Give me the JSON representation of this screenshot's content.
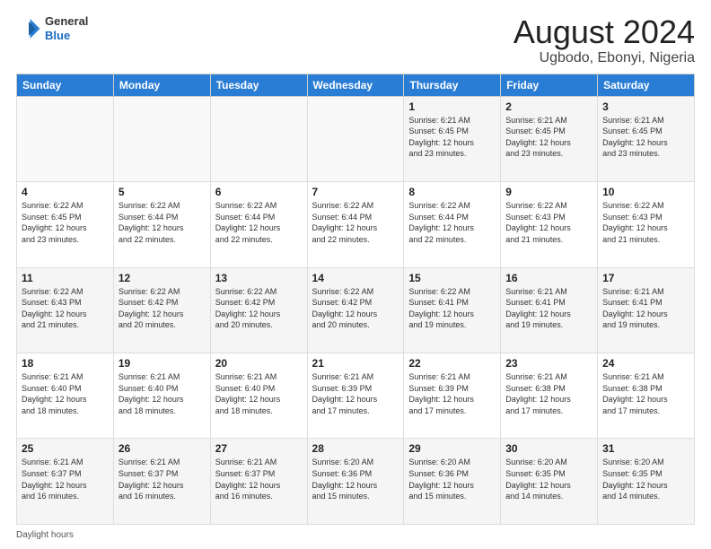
{
  "logo": {
    "general": "General",
    "blue": "Blue"
  },
  "title": "August 2024",
  "subtitle": "Ugbodo, Ebonyi, Nigeria",
  "days_of_week": [
    "Sunday",
    "Monday",
    "Tuesday",
    "Wednesday",
    "Thursday",
    "Friday",
    "Saturday"
  ],
  "footer_label": "Daylight hours",
  "weeks": [
    [
      {
        "day": "",
        "info": ""
      },
      {
        "day": "",
        "info": ""
      },
      {
        "day": "",
        "info": ""
      },
      {
        "day": "",
        "info": ""
      },
      {
        "day": "1",
        "info": "Sunrise: 6:21 AM\nSunset: 6:45 PM\nDaylight: 12 hours\nand 23 minutes."
      },
      {
        "day": "2",
        "info": "Sunrise: 6:21 AM\nSunset: 6:45 PM\nDaylight: 12 hours\nand 23 minutes."
      },
      {
        "day": "3",
        "info": "Sunrise: 6:21 AM\nSunset: 6:45 PM\nDaylight: 12 hours\nand 23 minutes."
      }
    ],
    [
      {
        "day": "4",
        "info": "Sunrise: 6:22 AM\nSunset: 6:45 PM\nDaylight: 12 hours\nand 23 minutes."
      },
      {
        "day": "5",
        "info": "Sunrise: 6:22 AM\nSunset: 6:44 PM\nDaylight: 12 hours\nand 22 minutes."
      },
      {
        "day": "6",
        "info": "Sunrise: 6:22 AM\nSunset: 6:44 PM\nDaylight: 12 hours\nand 22 minutes."
      },
      {
        "day": "7",
        "info": "Sunrise: 6:22 AM\nSunset: 6:44 PM\nDaylight: 12 hours\nand 22 minutes."
      },
      {
        "day": "8",
        "info": "Sunrise: 6:22 AM\nSunset: 6:44 PM\nDaylight: 12 hours\nand 22 minutes."
      },
      {
        "day": "9",
        "info": "Sunrise: 6:22 AM\nSunset: 6:43 PM\nDaylight: 12 hours\nand 21 minutes."
      },
      {
        "day": "10",
        "info": "Sunrise: 6:22 AM\nSunset: 6:43 PM\nDaylight: 12 hours\nand 21 minutes."
      }
    ],
    [
      {
        "day": "11",
        "info": "Sunrise: 6:22 AM\nSunset: 6:43 PM\nDaylight: 12 hours\nand 21 minutes."
      },
      {
        "day": "12",
        "info": "Sunrise: 6:22 AM\nSunset: 6:42 PM\nDaylight: 12 hours\nand 20 minutes."
      },
      {
        "day": "13",
        "info": "Sunrise: 6:22 AM\nSunset: 6:42 PM\nDaylight: 12 hours\nand 20 minutes."
      },
      {
        "day": "14",
        "info": "Sunrise: 6:22 AM\nSunset: 6:42 PM\nDaylight: 12 hours\nand 20 minutes."
      },
      {
        "day": "15",
        "info": "Sunrise: 6:22 AM\nSunset: 6:41 PM\nDaylight: 12 hours\nand 19 minutes."
      },
      {
        "day": "16",
        "info": "Sunrise: 6:21 AM\nSunset: 6:41 PM\nDaylight: 12 hours\nand 19 minutes."
      },
      {
        "day": "17",
        "info": "Sunrise: 6:21 AM\nSunset: 6:41 PM\nDaylight: 12 hours\nand 19 minutes."
      }
    ],
    [
      {
        "day": "18",
        "info": "Sunrise: 6:21 AM\nSunset: 6:40 PM\nDaylight: 12 hours\nand 18 minutes."
      },
      {
        "day": "19",
        "info": "Sunrise: 6:21 AM\nSunset: 6:40 PM\nDaylight: 12 hours\nand 18 minutes."
      },
      {
        "day": "20",
        "info": "Sunrise: 6:21 AM\nSunset: 6:40 PM\nDaylight: 12 hours\nand 18 minutes."
      },
      {
        "day": "21",
        "info": "Sunrise: 6:21 AM\nSunset: 6:39 PM\nDaylight: 12 hours\nand 17 minutes."
      },
      {
        "day": "22",
        "info": "Sunrise: 6:21 AM\nSunset: 6:39 PM\nDaylight: 12 hours\nand 17 minutes."
      },
      {
        "day": "23",
        "info": "Sunrise: 6:21 AM\nSunset: 6:38 PM\nDaylight: 12 hours\nand 17 minutes."
      },
      {
        "day": "24",
        "info": "Sunrise: 6:21 AM\nSunset: 6:38 PM\nDaylight: 12 hours\nand 17 minutes."
      }
    ],
    [
      {
        "day": "25",
        "info": "Sunrise: 6:21 AM\nSunset: 6:37 PM\nDaylight: 12 hours\nand 16 minutes."
      },
      {
        "day": "26",
        "info": "Sunrise: 6:21 AM\nSunset: 6:37 PM\nDaylight: 12 hours\nand 16 minutes."
      },
      {
        "day": "27",
        "info": "Sunrise: 6:21 AM\nSunset: 6:37 PM\nDaylight: 12 hours\nand 16 minutes."
      },
      {
        "day": "28",
        "info": "Sunrise: 6:20 AM\nSunset: 6:36 PM\nDaylight: 12 hours\nand 15 minutes."
      },
      {
        "day": "29",
        "info": "Sunrise: 6:20 AM\nSunset: 6:36 PM\nDaylight: 12 hours\nand 15 minutes."
      },
      {
        "day": "30",
        "info": "Sunrise: 6:20 AM\nSunset: 6:35 PM\nDaylight: 12 hours\nand 14 minutes."
      },
      {
        "day": "31",
        "info": "Sunrise: 6:20 AM\nSunset: 6:35 PM\nDaylight: 12 hours\nand 14 minutes."
      }
    ]
  ]
}
